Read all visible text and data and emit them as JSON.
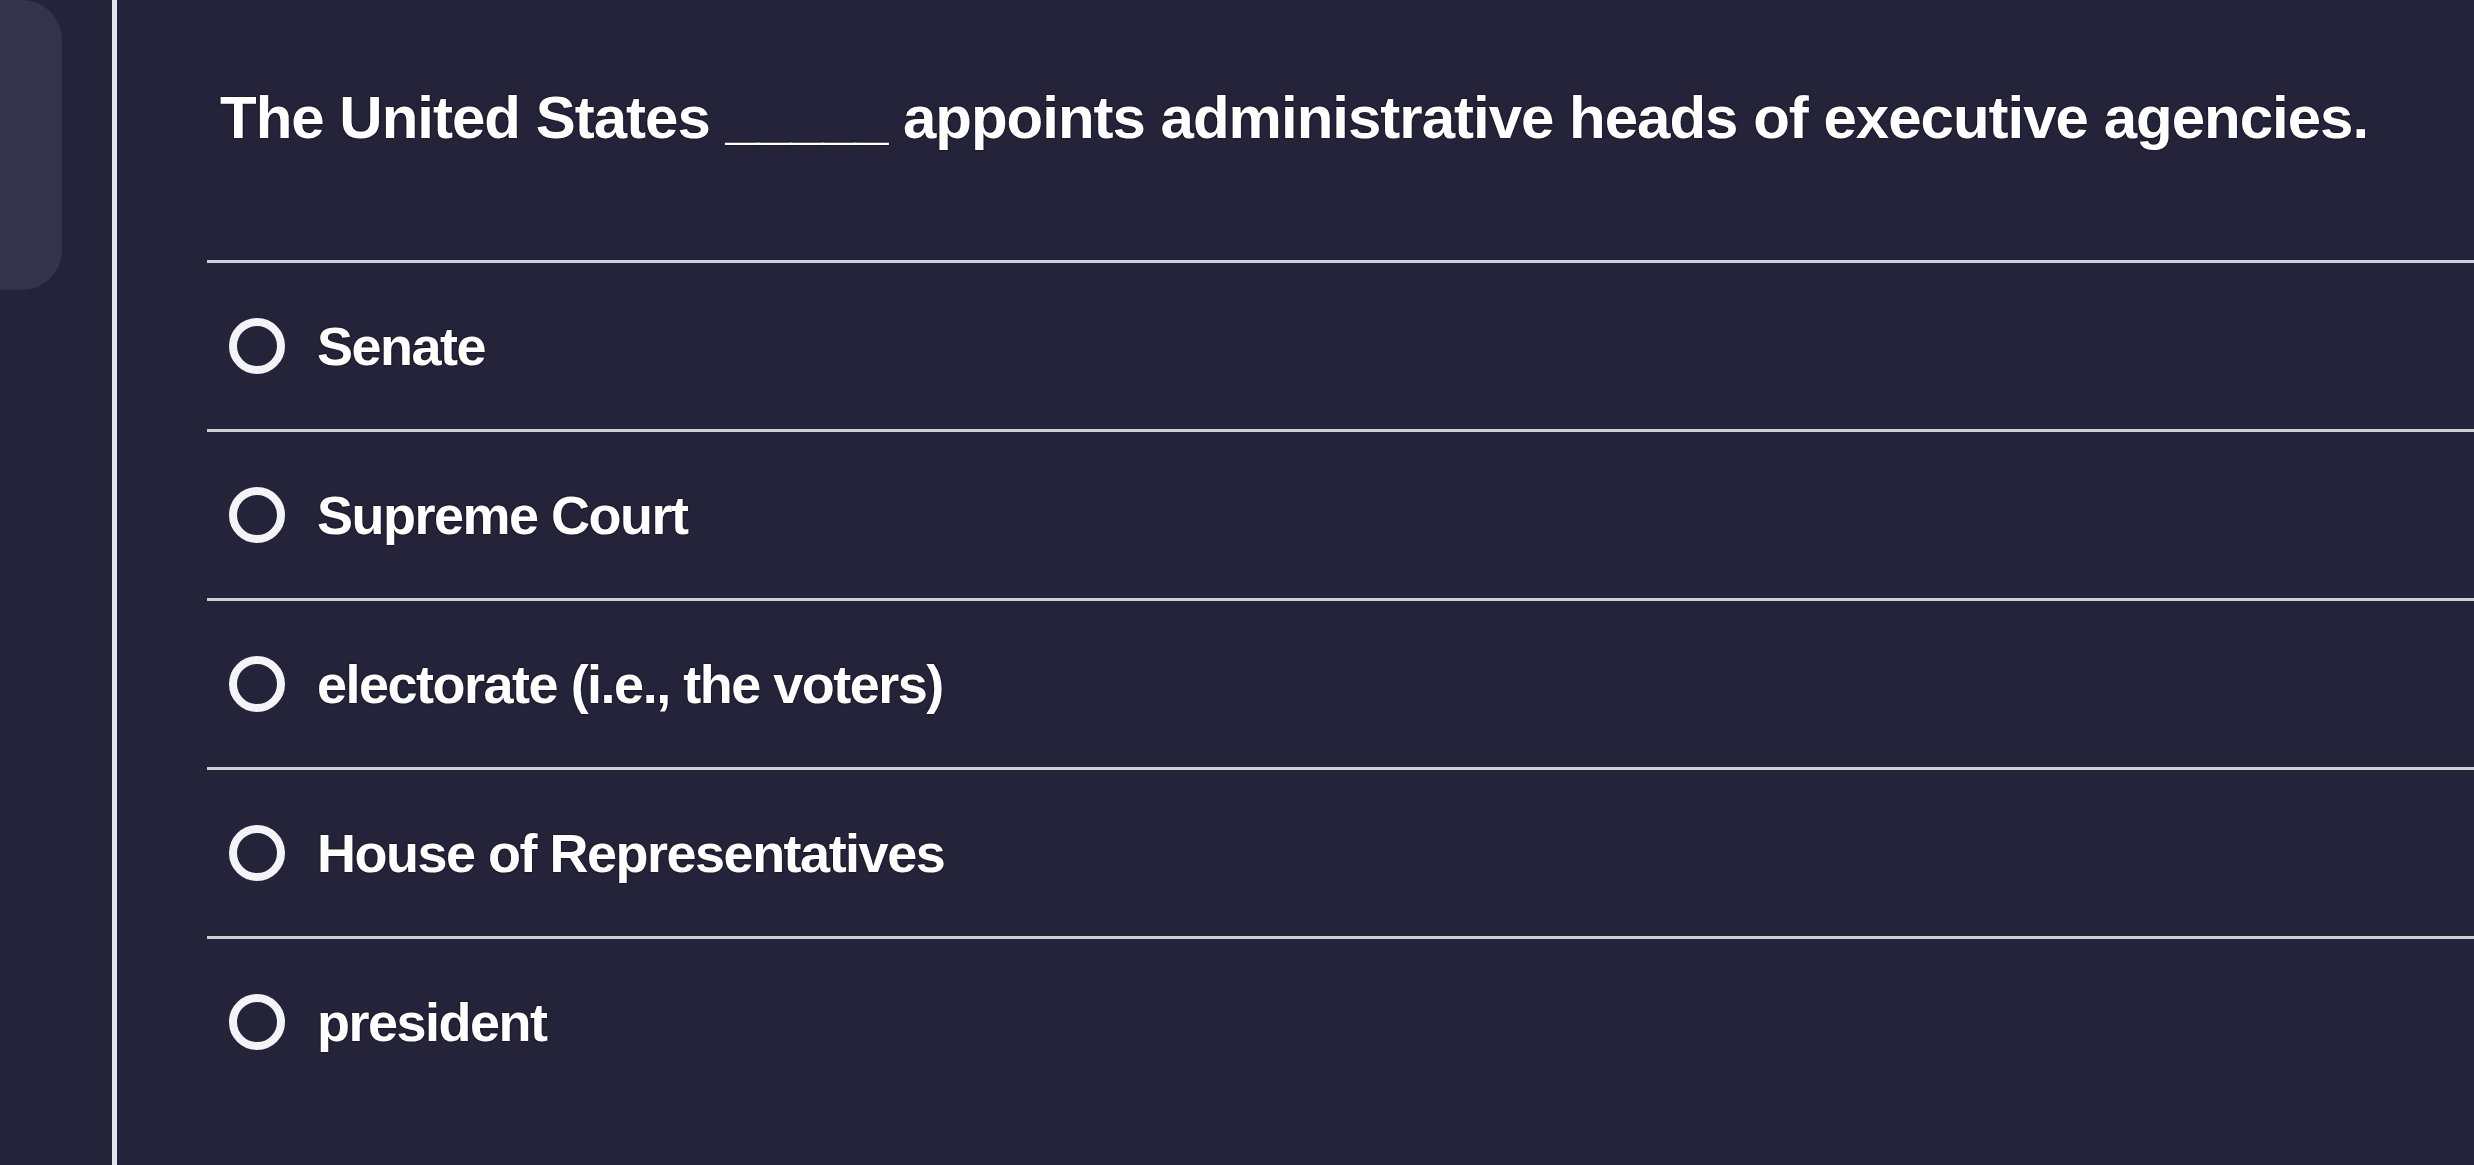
{
  "question": {
    "text": "The United States _____ appoints administrative heads of executive agencies."
  },
  "options": [
    {
      "label": "Senate",
      "selected": false
    },
    {
      "label": "Supreme Court",
      "selected": false
    },
    {
      "label": "electorate (i.e., the voters)",
      "selected": false
    },
    {
      "label": "House of Representatives",
      "selected": false
    },
    {
      "label": "president",
      "selected": false
    }
  ]
}
